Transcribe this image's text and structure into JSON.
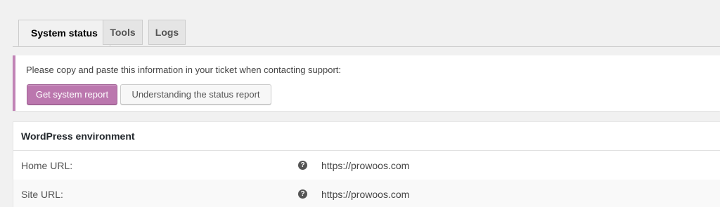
{
  "tabs": [
    {
      "label": "System status",
      "active": true
    },
    {
      "label": "Tools",
      "active": false
    },
    {
      "label": "Logs",
      "active": false
    }
  ],
  "notice": {
    "text": "Please copy and paste this information in your ticket when contacting support:",
    "primary_button": "Get system report",
    "secondary_button": "Understanding the status report",
    "accent_color": "#c184b6"
  },
  "environment": {
    "heading": "WordPress environment",
    "rows": [
      {
        "label": "Home URL:",
        "help_icon": "question-circle-icon",
        "value": "https://prowoos.com"
      },
      {
        "label": "Site URL:",
        "help_icon": "question-circle-icon",
        "value": "https://prowoos.com"
      }
    ]
  },
  "colors": {
    "primary_button_bg": "#bb77ae",
    "background": "#f1f1f1"
  }
}
